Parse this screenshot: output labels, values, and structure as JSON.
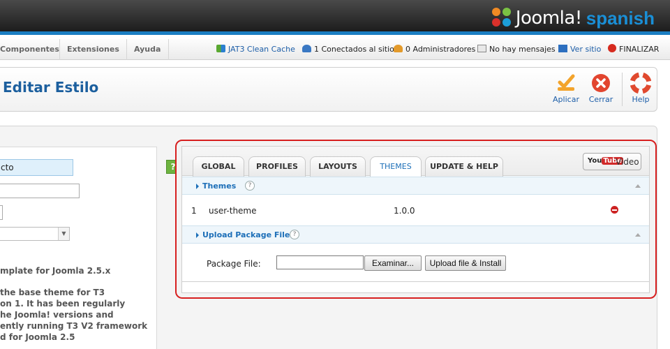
{
  "brand": {
    "logo_text": "Joomla!",
    "logo_sub": "spanish",
    "accent": "#1b7ec2"
  },
  "menu": {
    "items": [
      {
        "label": "Componentes"
      },
      {
        "label": "Extensiones"
      },
      {
        "label": "Ayuda"
      }
    ]
  },
  "status": {
    "cache": "JAT3 Clean Cache",
    "connected": "1 Conectados al sitio",
    "admins": "0 Administradores",
    "messages": "No hay mensajes",
    "view_site": "Ver sitio",
    "logout": "FINALIZAR"
  },
  "toolbar": {
    "title": "Editar Estilo",
    "apply_label": "Aplicar",
    "close_label": "Cerrar",
    "help_label": "Help"
  },
  "left": {
    "name_value": "cto",
    "description_lines": [
      "mplate for Joomla 2.5.x",
      "",
      "the base theme for T3",
      "on 1. It has been regularly",
      "he Joomla! versions and",
      "ently running T3 V2 framework",
      "d for Joomla 2.5"
    ]
  },
  "tabs": [
    {
      "label": "GLOBAL"
    },
    {
      "label": "PROFILES"
    },
    {
      "label": "LAYOUTS"
    },
    {
      "label": "THEMES",
      "active": true
    },
    {
      "label": "UPDATE & HELP"
    }
  ],
  "video": {
    "yt_a": "You",
    "yt_b": "Tube",
    "label": "Video"
  },
  "themes": {
    "title": "Themes",
    "rows": [
      {
        "index": "1",
        "name": "user-theme",
        "version": "1.0.0"
      }
    ]
  },
  "upload": {
    "title": "Upload Package File",
    "file_label": "Package File:",
    "browse_label": "Examinar...",
    "install_label": "Upload file & Install"
  }
}
